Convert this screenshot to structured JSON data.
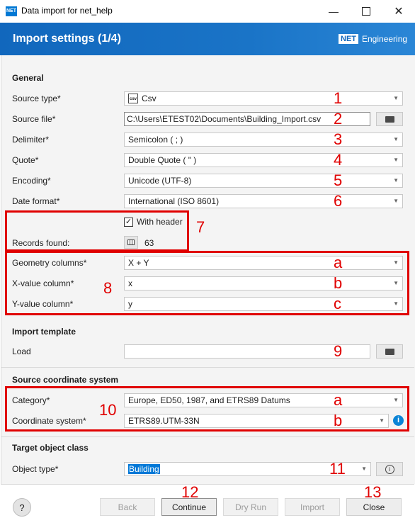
{
  "window": {
    "title": "Data import for net_help",
    "app_icon": "NET"
  },
  "header": {
    "title": "Import settings (1/4)",
    "brand_net": "NET",
    "brand_text": "Engineering"
  },
  "general": {
    "section": "General",
    "source_type": {
      "label": "Source type*",
      "value": "Csv",
      "icon": "csv-file-icon"
    },
    "source_file": {
      "label": "Source file*",
      "value": "C:\\Users\\ETEST02\\Documents\\Building_Import.csv"
    },
    "delimiter": {
      "label": "Delimiter*",
      "value": "Semicolon ( ; )"
    },
    "quote": {
      "label": "Quote*",
      "value": "Double Quote ( \" )"
    },
    "encoding": {
      "label": "Encoding*",
      "value": "Unicode (UTF-8)"
    },
    "date_format": {
      "label": "Date format*",
      "value": "International (ISO 8601)"
    },
    "with_header": {
      "label": "With header",
      "checked": true
    },
    "records": {
      "label": "Records found:",
      "value": "63"
    },
    "geometry_columns": {
      "label": "Geometry columns*",
      "value": "X + Y"
    },
    "x_column": {
      "label": "X-value column*",
      "value": "x"
    },
    "y_column": {
      "label": "Y-value column*",
      "value": "y"
    }
  },
  "import_template": {
    "section": "Import template",
    "load_label": "Load",
    "load_value": ""
  },
  "source_crs": {
    "section": "Source coordinate system",
    "category": {
      "label": "Category*",
      "value": "Europe, ED50, 1987, and ETRS89 Datums"
    },
    "coordinate_system": {
      "label": "Coordinate system*",
      "value": "ETRS89.UTM-33N"
    }
  },
  "target": {
    "section": "Target object class",
    "object_type": {
      "label": "Object type*",
      "value": "Building"
    }
  },
  "footer": {
    "help": "?",
    "back": "Back",
    "continue": "Continue",
    "dry_run": "Dry Run",
    "import": "Import",
    "close": "Close"
  },
  "annotations": {
    "n1": "1",
    "n2": "2",
    "n3": "3",
    "n4": "4",
    "n5": "5",
    "n6": "6",
    "n7": "7",
    "n8": "8",
    "n9": "9",
    "n10": "10",
    "n11": "11",
    "n12": "12",
    "n13": "13",
    "a1": "a",
    "b1": "b",
    "c1": "c",
    "a2": "a",
    "b2": "b"
  },
  "colors": {
    "accent": "#1167bd",
    "annotation": "#e00000",
    "info": "#0a84d6"
  }
}
